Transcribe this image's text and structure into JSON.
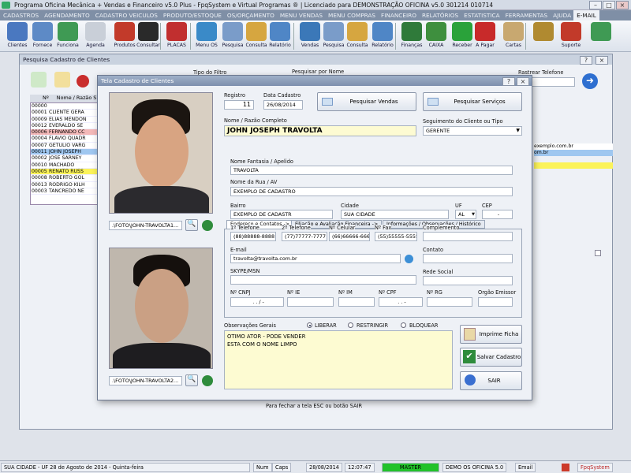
{
  "titlebar": {
    "title": "Programa Oficina Mecânica + Vendas e Financeiro v5.0 Plus - FpqSystem e Virtual Programas ® | Licenciado para  DEMONSTRAÇÃO OFICINA v5.0 301214 010714"
  },
  "menu": [
    "CADASTROS",
    "AGENDAMENTO",
    "CADASTRO VEICULOS",
    "PRODUTO/ESTOQUE",
    "OS/ORÇAMENTO",
    "MENU VENDAS",
    "MENU COMPRAS",
    "FINANCEIRO",
    "RELATÓRIOS",
    "ESTATISTICA",
    "FERRAMENTAS",
    "AJUDA"
  ],
  "menu_email": "E-MAIL",
  "toolbar": [
    {
      "label": "Clientes",
      "icon": "clients-icon",
      "color": "#4a78c0"
    },
    {
      "label": "Fornece",
      "icon": "suppliers-icon",
      "color": "#5d8ac6"
    },
    {
      "label": "Funciona",
      "icon": "employees-icon",
      "color": "#3f9a54"
    },
    {
      "label": "Agenda",
      "icon": "calendar-icon",
      "color": "#c9cfd8"
    },
    {
      "label": "Produtos",
      "icon": "products-icon",
      "color": "#c23a2a"
    },
    {
      "label": "Consultar",
      "icon": "tire-icon",
      "color": "#2a2a2a"
    },
    {
      "label": "PLACAS",
      "icon": "plates-icon",
      "color": "#c12f2f"
    },
    {
      "label": "Menu OS",
      "icon": "service-order-icon",
      "color": "#3a8ac8"
    },
    {
      "label": "Pesquisa",
      "icon": "search-doc-icon",
      "color": "#7a9cc9"
    },
    {
      "label": "Consulta",
      "icon": "folder-icon",
      "color": "#d6a640"
    },
    {
      "label": "Relatório",
      "icon": "report-icon",
      "color": "#4f86c6"
    },
    {
      "label": "Vendas",
      "icon": "monitor-icon",
      "color": "#3b78b8"
    },
    {
      "label": "Pesquisa",
      "icon": "search-doc-icon",
      "color": "#7a9cc9"
    },
    {
      "label": "Consulta",
      "icon": "folder-icon",
      "color": "#d6a640"
    },
    {
      "label": "Relatório",
      "icon": "report-icon",
      "color": "#4f86c6"
    },
    {
      "label": "Finanças",
      "icon": "finance-icon",
      "color": "#2f7a3a"
    },
    {
      "label": "CAIXA",
      "icon": "cashbox-icon",
      "color": "#3e8f3e"
    },
    {
      "label": "Receber",
      "icon": "receive-money-icon",
      "color": "#2aa23a"
    },
    {
      "label": "A Pagar",
      "icon": "pay-money-icon",
      "color": "#c82a2a"
    },
    {
      "label": "Cartas",
      "icon": "letters-icon",
      "color": "#c8a870"
    },
    {
      "label": "",
      "icon": "tools-icon",
      "color": "#b08a30"
    },
    {
      "label": "Suporte",
      "icon": "support-icon",
      "color": "#c23a2a"
    },
    {
      "label": "",
      "icon": "exit-icon",
      "color": "#3f9a54"
    }
  ],
  "bgwin": {
    "title": "Pesquisa Cadastro de Clientes",
    "tipo_filtro": "Tipo do Filtro",
    "pesquisar_nome": "Pesquisar por Nome",
    "rastrear_tel": "Rastrear Telefone",
    "col_n": "Nº",
    "col_nome": "Nome / Razão S",
    "rows": [
      {
        "n": "00000",
        "nome": ""
      },
      {
        "n": "00001",
        "nome": "CLIENTE GERA"
      },
      {
        "n": "00009",
        "nome": "ELIAS MENDON"
      },
      {
        "n": "00012",
        "nome": "EVERALDO SE"
      },
      {
        "n": "00006",
        "nome": "FERNANDO CC"
      },
      {
        "n": "00004",
        "nome": "FLAVIO QUADR"
      },
      {
        "n": "00007",
        "nome": "GETULIO VARG"
      },
      {
        "n": "00011",
        "nome": "JOHN JOSEPH"
      },
      {
        "n": "00002",
        "nome": "JOSE SARNEY"
      },
      {
        "n": "00010",
        "nome": "MACHADO"
      },
      {
        "n": "00005",
        "nome": "RENATO RUSS"
      },
      {
        "n": "00008",
        "nome": "ROBERTO GOL"
      },
      {
        "n": "00013",
        "nome": "RODRIGO KILH"
      },
      {
        "n": "00003",
        "nome": "TANCREDO NE"
      }
    ],
    "right_snips": [
      "exemplo.com.br",
      "om.br"
    ],
    "footer": "Para fechar a tela ESC ou botão SAIR",
    "colors": {
      "red_row": "#f3b8b8",
      "yellow_row": "#fbf35a",
      "sel_row": "#9fc7f0"
    }
  },
  "dialog": {
    "title": "Tela Cadastro de Clientes",
    "photo1_path": ".\\FOTO\\JOHN-TRAVOLTA1...",
    "photo2_path": ".\\FOTO\\JOHN-TRAVOLTA2...",
    "registro_label": "Registro",
    "registro": "11",
    "data_label": "Data Cadastro",
    "data": "26/08/2014",
    "btn_vendas": "Pesquisar Vendas",
    "btn_servicos": "Pesquisar Serviços",
    "nome_label": "Nome / Razão Completo",
    "nome": "JOHN JOSEPH TRAVOLTA",
    "segmento_label": "Seguimento do Cliente ou Tipo",
    "segmento": "GERENTE",
    "tabs": [
      "Endereço e Contatos ->",
      "Filiação e Avaliação Financeira ->",
      "Informações / Observações / Histórico"
    ],
    "fantasia_label": "Nome Fantasia / Apelido",
    "fantasia": "TRAVOLTA",
    "rua_label": "Nome da Rua / AV",
    "rua": "EXEMPLO DE CADASTRO",
    "bairro_label": "Bairro",
    "bairro": "EXEMPLO DE CADASTR",
    "cidade_label": "Cidade",
    "cidade": "SUA CIDADE",
    "uf_label": "UF",
    "uf": "AL",
    "cep_label": "CEP",
    "cep": "-",
    "tel1_label": "1º Telefone",
    "tel1": "(88)88888-8888",
    "tel2_label": "2º Telefone",
    "tel2": "(77)77777-7777",
    "cel_label": "Nº Celular",
    "cel": "(66)66666-6666",
    "fax_label": "Nº Fax",
    "fax": "(55)55555-5555",
    "complemento_label": "Complemento",
    "email_label": "E-mail",
    "email": "travolta@travolta.com.br",
    "contato_label": "Contato",
    "skype_label": "SKYPE/MSN",
    "rede_label": "Rede Social",
    "cnpj_label": "Nº CNPJ",
    "cnpj": ". . / -",
    "ie_label": "Nº IE",
    "im_label": "Nº IM",
    "cpf_label": "Nº CPF",
    "cpf": ". . -",
    "rg_label": "Nº RG",
    "orgao_label": "Orgão Emissor",
    "obs_label": "Observações Gerais",
    "radio_liberar": "LIBERAR",
    "radio_restringir": "RESTRINGIR",
    "radio_bloquear": "BLOQUEAR",
    "obs_line1": "OTIMO ATOR - PODE VENDER",
    "obs_line2": "ESTA COM O NOME LIMPO",
    "btn_imprime": "Imprime Ficha",
    "btn_salvar": "Salvar Cadastro",
    "btn_sair": "SAIR"
  },
  "status": {
    "left": "SUA CIDADE - UF 28 de Agosto de 2014 - Quinta-feira",
    "num": "Num",
    "caps": "Caps",
    "date": "28/08/2014",
    "time": "12:07:47",
    "master": "MASTER",
    "demo": "DEMO OS OFICINA 5.0",
    "email": "Email",
    "brand": "FpqSystem",
    "master_color": "#22c22a"
  }
}
